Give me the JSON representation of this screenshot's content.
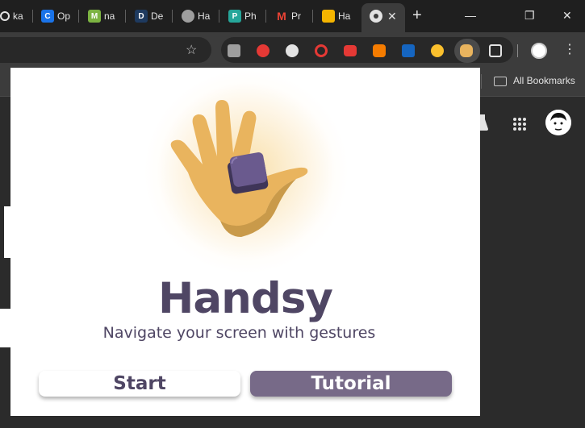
{
  "browser": {
    "tabs": [
      {
        "label": "ka",
        "icon": "github-icon",
        "color": "#333333"
      },
      {
        "label": "Op",
        "icon": "c-logo-icon",
        "color": "#1a73e8"
      },
      {
        "label": "na",
        "icon": "m-logo-icon",
        "color": "#7cb342"
      },
      {
        "label": "De",
        "icon": "d-logo-icon",
        "color": "#1e3a5f"
      },
      {
        "label": "Ha",
        "icon": "globe-icon",
        "color": "#9e9e9e"
      },
      {
        "label": "Ph",
        "icon": "p-logo-icon",
        "color": "#26a69a"
      },
      {
        "label": "Pr",
        "icon": "gmail-icon",
        "color": "#ea4335"
      },
      {
        "label": "Ha",
        "icon": "slides-icon",
        "color": "#f4b400"
      }
    ],
    "active_tab_close": "✕",
    "new_tab": "+",
    "window_controls": {
      "minimize": "—",
      "restore": "❐",
      "close": "✕"
    },
    "bookmarks_label": "All Bookmarks",
    "menu": "⋮",
    "star": "☆"
  },
  "popup": {
    "title": "Handsy",
    "subtitle": "Navigate your screen with gestures",
    "start_label": "Start",
    "tutorial_label": "Tutorial",
    "colors": {
      "primary": "#4f4664",
      "button_accent": "#776a88",
      "hand": "#e9b45e",
      "cube": "#5e4f7f"
    }
  }
}
